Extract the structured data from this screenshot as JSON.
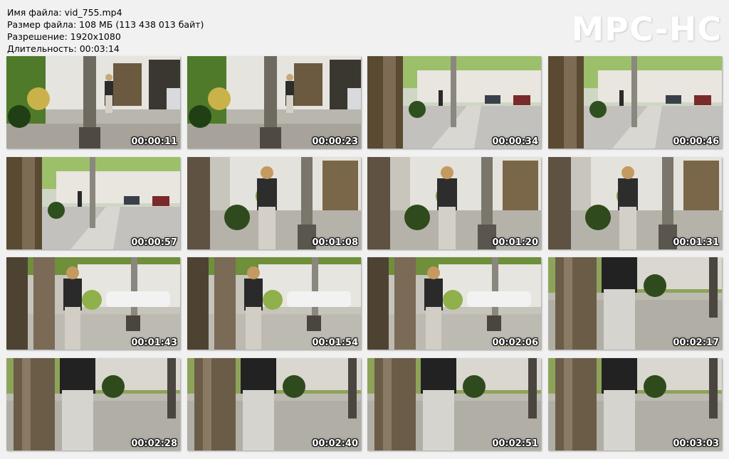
{
  "file_info": {
    "name": "Имя файла: vid_755.mp4",
    "size": "Размер файла: 108 МБ (113 438 013 байт)",
    "resolution": "Разрешение: 1920x1080",
    "duration": "Длительность: 00:03:14"
  },
  "logo": "MPC-HC",
  "thumbnails": [
    {
      "time": "00:00:11",
      "scene": "a"
    },
    {
      "time": "00:00:23",
      "scene": "a"
    },
    {
      "time": "00:00:34",
      "scene": "b"
    },
    {
      "time": "00:00:46",
      "scene": "b"
    },
    {
      "time": "00:00:57",
      "scene": "b"
    },
    {
      "time": "00:01:08",
      "scene": "c"
    },
    {
      "time": "00:01:20",
      "scene": "c"
    },
    {
      "time": "00:01:31",
      "scene": "c"
    },
    {
      "time": "00:01:43",
      "scene": "d"
    },
    {
      "time": "00:01:54",
      "scene": "d"
    },
    {
      "time": "00:02:06",
      "scene": "d"
    },
    {
      "time": "00:02:17",
      "scene": "e"
    },
    {
      "time": "00:02:28",
      "scene": "e"
    },
    {
      "time": "00:02:40",
      "scene": "e"
    },
    {
      "time": "00:02:51",
      "scene": "e"
    },
    {
      "time": "00:03:03",
      "scene": "e"
    }
  ],
  "colors": {
    "background": "#f1f1f1",
    "timestamp_text": "#ffffff"
  }
}
